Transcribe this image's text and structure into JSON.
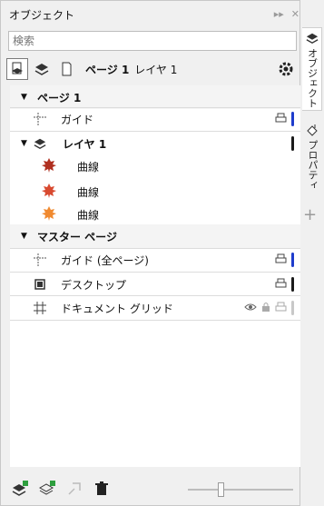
{
  "panel": {
    "title": "オブジェクト"
  },
  "search": {
    "placeholder": "検索"
  },
  "toolbar": {
    "page_label": "ページ 1",
    "layer_label": "レイヤ 1"
  },
  "tree": {
    "page1": {
      "header": "ページ 1",
      "guide": "ガイド",
      "layer": {
        "label": "レイヤ 1",
        "items": [
          {
            "label": "曲線",
            "color": "#b03020"
          },
          {
            "label": "曲線",
            "color": "#d84a30"
          },
          {
            "label": "曲線",
            "color": "#f08a30"
          }
        ]
      }
    },
    "master": {
      "header": "マスター ページ",
      "guides_all": "ガイド (全ページ)",
      "desktop": "デスクトップ",
      "doc_grid": "ドキュメント グリッド"
    }
  },
  "side_tabs": {
    "objects": "オブジェクト",
    "properties": "プロパティ"
  },
  "colors": {
    "blue_bar": "#1e3ccc",
    "black_bar": "#1a1a1a",
    "grey_bar": "#c8c8c8"
  },
  "slider": {
    "position": 0.3
  }
}
